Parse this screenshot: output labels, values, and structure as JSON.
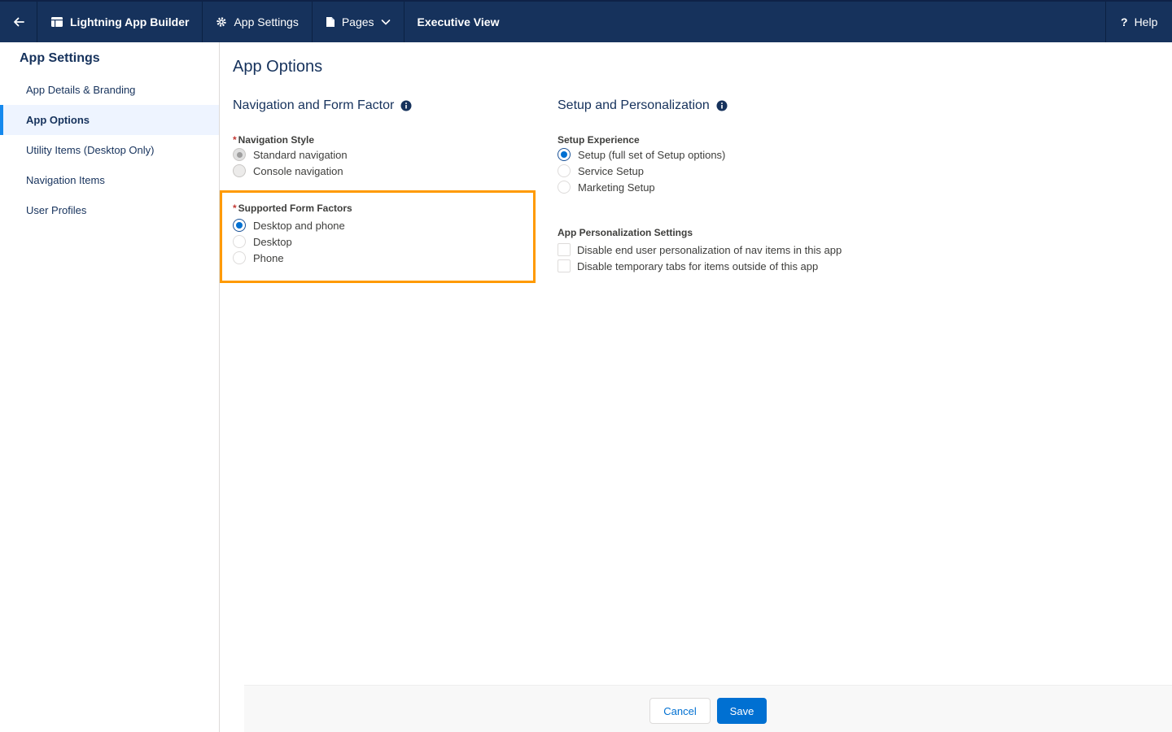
{
  "topbar": {
    "builder_label": "Lightning App Builder",
    "settings_label": "App Settings",
    "pages_label": "Pages",
    "app_name": "Executive View",
    "help_label": "Help"
  },
  "sidebar": {
    "title": "App Settings",
    "items": [
      {
        "label": "App Details & Branding"
      },
      {
        "label": "App Options"
      },
      {
        "label": "Utility Items (Desktop Only)"
      },
      {
        "label": "Navigation Items"
      },
      {
        "label": "User Profiles"
      }
    ]
  },
  "main": {
    "title": "App Options",
    "nav_section": {
      "title": "Navigation and Form Factor",
      "nav_style_label": "Navigation Style",
      "nav_style_options": [
        "Standard navigation",
        "Console navigation"
      ],
      "nav_style_selected": "Standard navigation",
      "form_factor_label": "Supported Form Factors",
      "form_factor_options": [
        "Desktop and phone",
        "Desktop",
        "Phone"
      ],
      "form_factor_selected": "Desktop and phone"
    },
    "setup_section": {
      "title": "Setup and Personalization",
      "setup_label": "Setup Experience",
      "setup_options": [
        "Setup (full set of Setup options)",
        "Service Setup",
        "Marketing Setup"
      ],
      "setup_selected": "Setup (full set of Setup options)",
      "personalization_label": "App Personalization Settings",
      "personalization_options": [
        "Disable end user personalization of nav items in this app",
        "Disable temporary tabs for items outside of this app"
      ]
    }
  },
  "footer": {
    "cancel_label": "Cancel",
    "save_label": "Save"
  },
  "colors": {
    "header_bg": "#16325c",
    "brand_blue": "#0070d2",
    "highlight": "#ff9a00",
    "required": "#c23934"
  }
}
